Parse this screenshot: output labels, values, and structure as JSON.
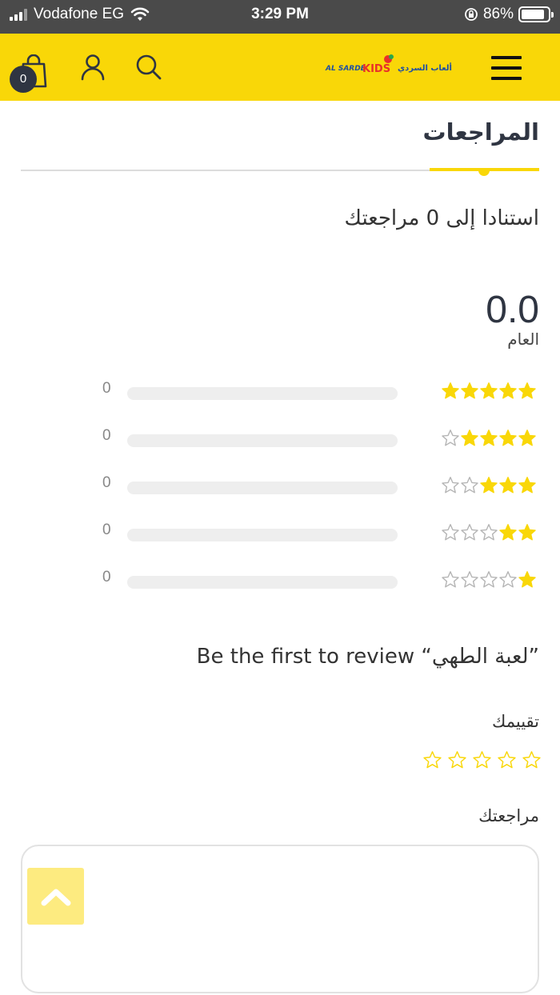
{
  "status_bar": {
    "carrier": "Vodafone EG",
    "time": "3:29 PM",
    "battery": "86%",
    "battery_level": 0.86
  },
  "header": {
    "cart_count": "0",
    "logo": {
      "text_latin": "AL SARDE",
      "text_kids": "KIDS",
      "text_arabic": "ألعاب السردي"
    },
    "colors": {
      "brand_yellow": "#f9d708",
      "dark": "#2f3542"
    },
    "icons": [
      "shopping-bag-icon",
      "user-icon",
      "search-icon",
      "hamburger-menu-icon"
    ]
  },
  "tab": {
    "title": "المراجعات"
  },
  "summary": {
    "based_on": "استنادا إلى 0 مراجعتك",
    "average": "0.0",
    "average_label": "العام"
  },
  "breakdown": [
    {
      "stars": 5,
      "count": "0",
      "fraction": 0
    },
    {
      "stars": 4,
      "count": "0",
      "fraction": 0
    },
    {
      "stars": 3,
      "count": "0",
      "fraction": 0
    },
    {
      "stars": 2,
      "count": "0",
      "fraction": 0
    },
    {
      "stars": 1,
      "count": "0",
      "fraction": 0
    }
  ],
  "form": {
    "first_review": "Be the first to review “لعبة الطهي”",
    "your_rating_label": "تقييمك",
    "your_rating_value": 0,
    "your_review_label": "مراجعتك",
    "review_value": ""
  }
}
